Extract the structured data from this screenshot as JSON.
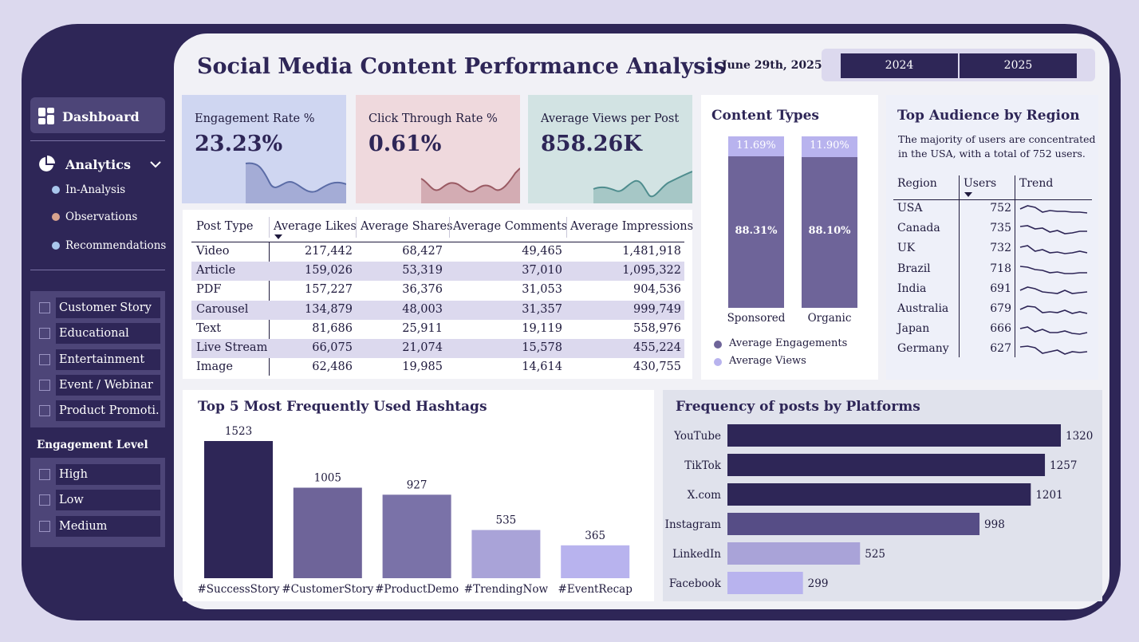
{
  "header": {
    "title": "Social Media Content Performance Analysis",
    "date": "June 29th, 2025",
    "years": [
      "2024",
      "2025"
    ]
  },
  "sidebar": {
    "dashboard": "Dashboard",
    "analytics": "Analytics",
    "sub": [
      {
        "label": "In-Analysis",
        "color": "#a9c6ec"
      },
      {
        "label": "Observations",
        "color": "#d8a38e"
      },
      {
        "label": "Recommendations",
        "color": "#a9c6ec"
      }
    ],
    "content_filters": [
      "Customer Story",
      "Educational",
      "Entertainment",
      "Event / Webinar",
      "Product Promoti..."
    ],
    "engagement_title": "Engagement Level",
    "engagement_filters": [
      "High",
      "Low",
      "Medium"
    ]
  },
  "kpis": [
    {
      "label": "Engagement Rate %",
      "value": "23.23%",
      "bg": "#cfd6f1",
      "line": "#5b6ca6",
      "fill": "#a4acd6"
    },
    {
      "label": "Click Through Rate %",
      "value": "0.61%",
      "bg": "#efd9dd",
      "line": "#9a5a63",
      "fill": "#d3acb3"
    },
    {
      "label": "Average Views per Post",
      "value": "858.26K",
      "bg": "#d2e3e3",
      "line": "#4f8d8e",
      "fill": "#a6c7c6"
    }
  ],
  "post_table": {
    "columns": [
      "Post Type",
      "Average Likes",
      "Average Shares",
      "Average Comments",
      "Average Impressions"
    ],
    "rows": [
      [
        "Video",
        "217,442",
        "68,427",
        "49,465",
        "1,481,918"
      ],
      [
        "Article",
        "159,026",
        "53,319",
        "37,010",
        "1,095,322"
      ],
      [
        "PDF",
        "157,227",
        "36,376",
        "31,053",
        "904,536"
      ],
      [
        "Carousel",
        "134,879",
        "48,003",
        "31,357",
        "999,749"
      ],
      [
        "Text",
        "81,686",
        "25,911",
        "19,119",
        "558,976"
      ],
      [
        "Live Stream",
        "66,075",
        "21,074",
        "15,578",
        "455,224"
      ],
      [
        "Image",
        "62,486",
        "19,985",
        "14,614",
        "430,755"
      ]
    ]
  },
  "content_types": {
    "title": "Content Types",
    "bars": [
      {
        "name": "Sponsored",
        "engagements_label": "88.31%",
        "views_label": "11.69%",
        "engagements": 88.31,
        "views": 11.69
      },
      {
        "name": "Organic",
        "engagements_label": "88.10%",
        "views_label": "11.90%",
        "engagements": 88.1,
        "views": 11.9
      }
    ],
    "legend": [
      {
        "label": "Average Engagements",
        "color": "#6e6499"
      },
      {
        "label": "Average Views",
        "color": "#b8b3ee"
      }
    ]
  },
  "region": {
    "title": "Top Audience by Region",
    "desc_line1": "The majority of users are concentrated",
    "desc_line2": "in the USA, with a total of 752 users.",
    "columns": [
      "Region",
      "Users",
      "Trend"
    ],
    "rows": [
      {
        "region": "USA",
        "users": "752",
        "trend": [
          8,
          4,
          6,
          12,
          10,
          11,
          11,
          12,
          12,
          13
        ]
      },
      {
        "region": "Canada",
        "users": "735",
        "trend": [
          5,
          4,
          8,
          7,
          12,
          10,
          14,
          13,
          11,
          11
        ]
      },
      {
        "region": "UK",
        "users": "732",
        "trend": [
          6,
          4,
          11,
          9,
          13,
          12,
          14,
          13,
          11,
          13
        ]
      },
      {
        "region": "Brazil",
        "users": "718",
        "trend": [
          4,
          5,
          8,
          9,
          12,
          11,
          13,
          13,
          12,
          12
        ]
      },
      {
        "region": "India",
        "users": "691",
        "trend": [
          9,
          5,
          7,
          11,
          12,
          13,
          9,
          13,
          12,
          11
        ]
      },
      {
        "region": "Australia",
        "users": "679",
        "trend": [
          8,
          4,
          5,
          12,
          11,
          12,
          9,
          13,
          11,
          13
        ]
      },
      {
        "region": "Japan",
        "users": "666",
        "trend": [
          7,
          5,
          11,
          8,
          12,
          12,
          10,
          13,
          14,
          12
        ]
      },
      {
        "region": "Germany",
        "users": "627",
        "trend": [
          5,
          4,
          6,
          13,
          11,
          9,
          14,
          11,
          12,
          11
        ]
      }
    ]
  },
  "hashtags_chart": {
    "title": "Top 5 Most Frequently Used Hashtags",
    "colors": [
      "#2e2657",
      "#6e6499",
      "#7a72a8",
      "#a9a3d8",
      "#b8b3ee"
    ],
    "chart_data": {
      "type": "bar",
      "categories": [
        "#SuccessStory",
        "#CustomerStory",
        "#ProductDemo",
        "#TrendingNow",
        "#EventRecap"
      ],
      "values": [
        1523,
        1005,
        927,
        535,
        365
      ]
    }
  },
  "platform_chart": {
    "title": "Frequency of posts by Platforms",
    "colors": [
      "#2e2657",
      "#2e2657",
      "#2e2657",
      "#564d86",
      "#a9a3d8",
      "#b8b3ee"
    ],
    "chart_data": {
      "type": "bar",
      "orientation": "horizontal",
      "categories": [
        "YouTube",
        "TikTok",
        "X.com",
        "Instagram",
        "LinkedIn",
        "Facebook"
      ],
      "values": [
        1320,
        1257,
        1201,
        998,
        525,
        299
      ]
    }
  }
}
